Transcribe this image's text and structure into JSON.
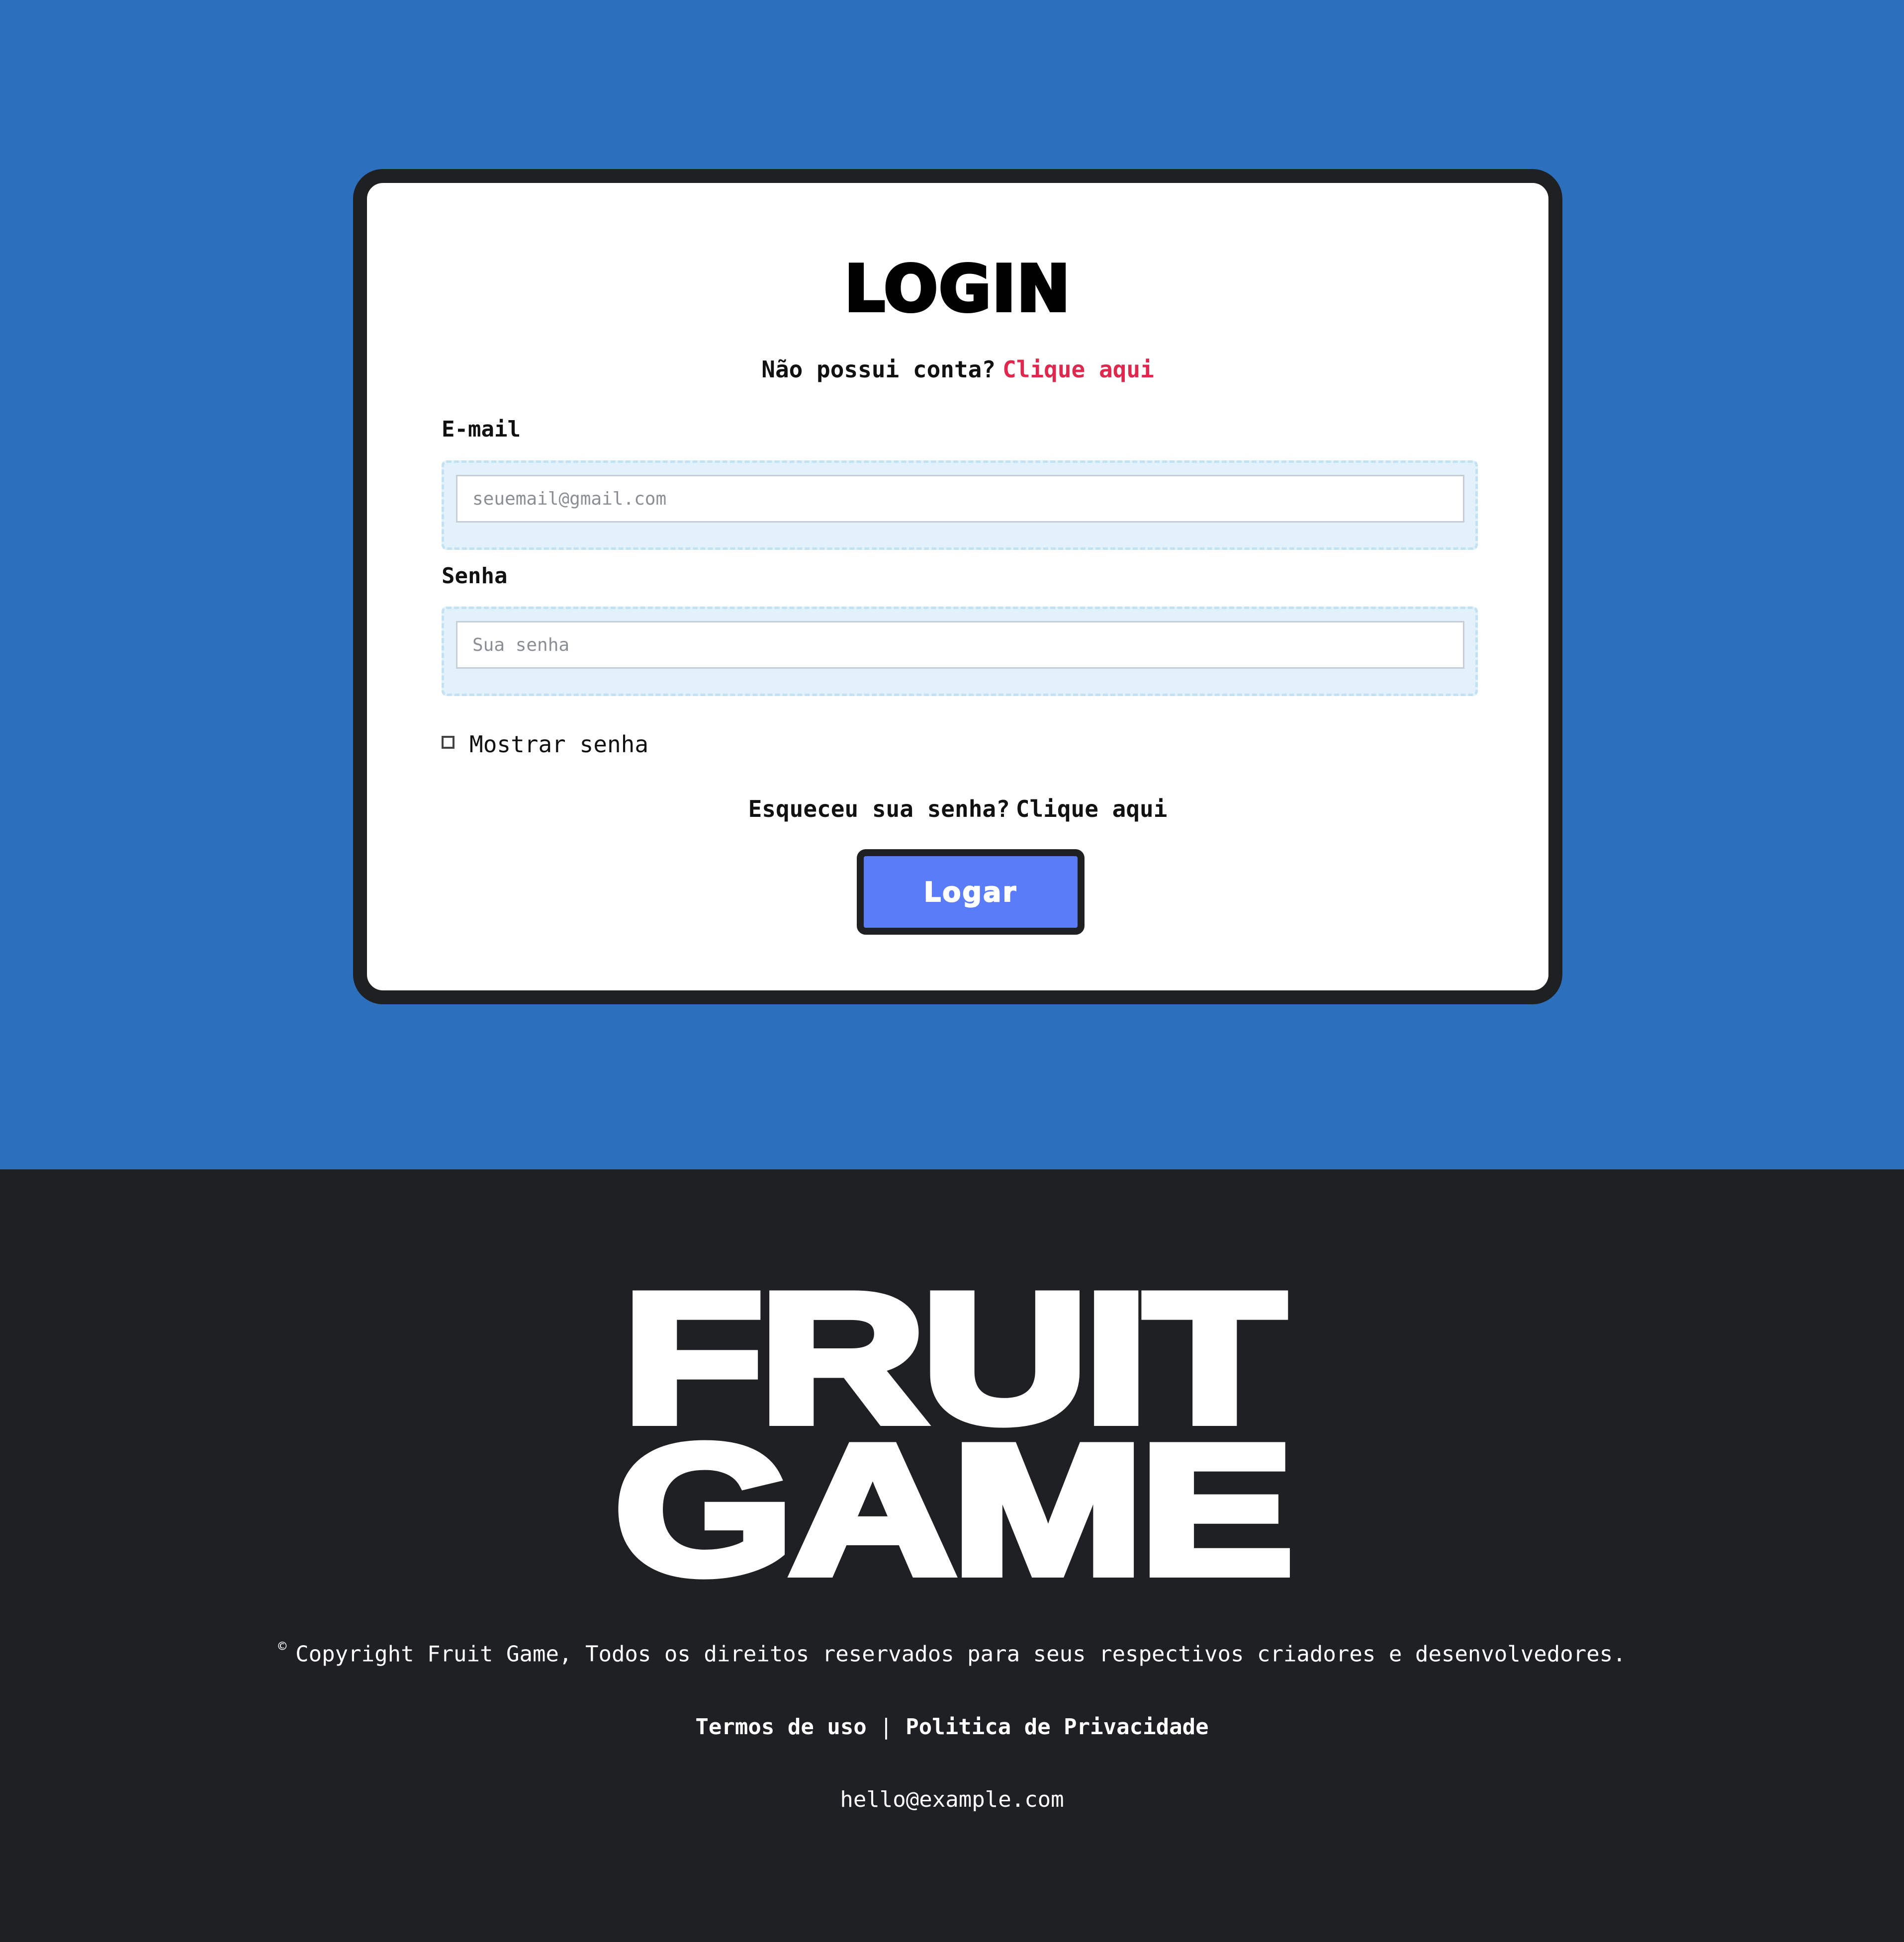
{
  "login": {
    "title": "LOGIN",
    "no_account_text": "Não possui conta?",
    "signup_link": "Clique aqui",
    "email_label": "E-mail",
    "email_placeholder": "seuemail@gmail.com",
    "password_label": "Senha",
    "password_placeholder": "Sua senha",
    "show_password_label": "Mostrar senha",
    "show_password_checked": false,
    "forgot_text": "Esqueceu sua senha?",
    "forgot_link": "Clique aqui",
    "submit_label": "Logar"
  },
  "footer": {
    "brand_line1": "FRUIT",
    "brand_line2": "GAME",
    "copyright_symbol": "©",
    "copyright_text": "Copyright Fruit Game, Todos os direitos reservados para seus respectivos criadores e desenvolvedores.",
    "terms_link": "Termos de uso",
    "separator": "|",
    "privacy_link": "Politica de Privacidade",
    "contact_email": "hello@example.com"
  },
  "colors": {
    "hero_background": "#2c6fbd",
    "card_border": "#1f2022",
    "link_accent": "#e0284e",
    "button_background": "#5a7cf9",
    "footer_background": "#1e2023"
  }
}
